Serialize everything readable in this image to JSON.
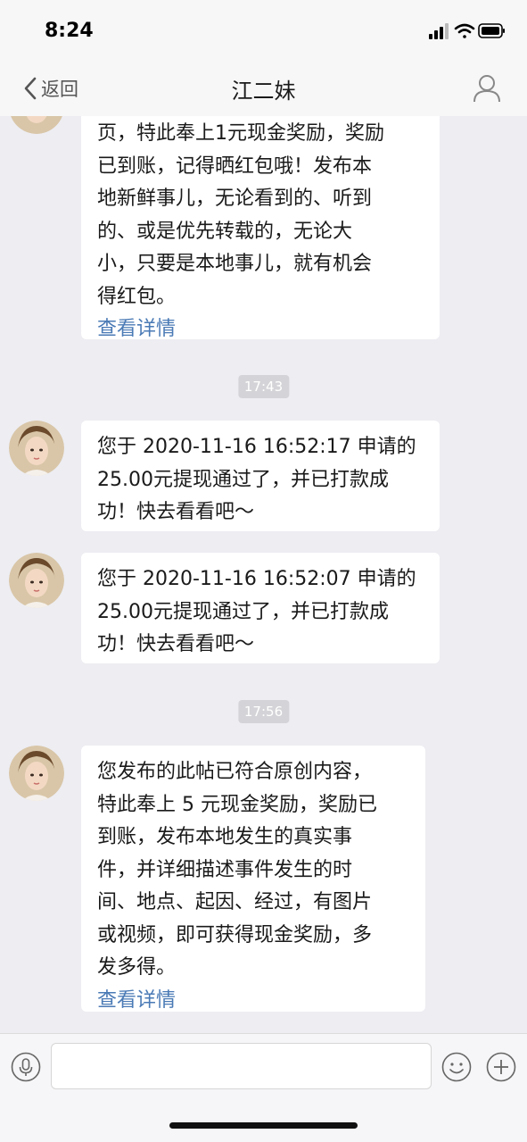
{
  "status_bar": {
    "time": "8:24"
  },
  "nav": {
    "back_label": "返回",
    "title": "江二妹"
  },
  "messages": [
    {
      "lines": [
        "页，特此奉上1元现金奖励，奖励",
        "已到账，记得晒红包哦！发布本",
        "地新鲜事儿，无论看到的、听到",
        "的、或是优先转载的，无论大",
        "小，只要是本地事儿，就有机会",
        "得红包。"
      ],
      "link": "查看详情"
    },
    {
      "timestamp": "17:43"
    },
    {
      "lines": [
        "您于 2020-11-16 16:52:17 申请的",
        "25.00元提现通过了，并已打款成",
        "功！快去看看吧～"
      ]
    },
    {
      "lines": [
        "您于 2020-11-16 16:52:07 申请的",
        "25.00元提现通过了，并已打款成",
        "功！快去看看吧～"
      ]
    },
    {
      "timestamp": "17:56"
    },
    {
      "lines": [
        "您发布的此帖已符合原创内容，",
        "特此奉上 5 元现金奖励，奖励已",
        "到账，发布本地发生的真实事",
        "件，并详细描述事件发生的时",
        "间、地点、起因、经过，有图片",
        "或视频，即可获得现金奖励，多",
        "发多得。"
      ],
      "link": "查看详情"
    }
  ],
  "input": {
    "value": "",
    "placeholder": ""
  },
  "icons": {
    "back": "chevron-left-icon",
    "profile": "person-icon",
    "voice": "microphone-icon",
    "emoji": "smiley-icon",
    "plus": "plus-icon"
  },
  "colors": {
    "link": "#4a7ab5",
    "background": "#ededf2",
    "bubble": "#ffffff",
    "timestamp_pill": "#d4d4d8"
  }
}
